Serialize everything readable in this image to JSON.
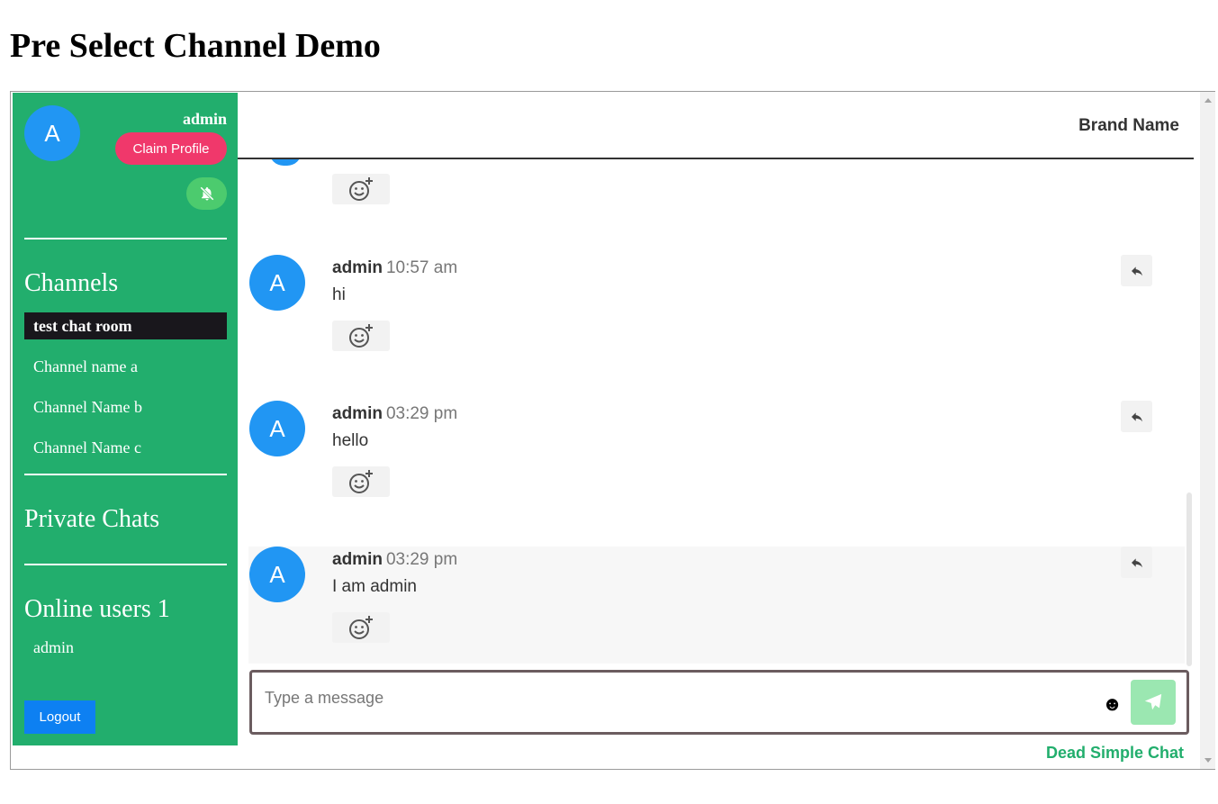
{
  "page": {
    "title": "Pre Select Channel Demo"
  },
  "sidebar": {
    "avatar_letter": "A",
    "username": "admin",
    "claim_profile_label": "Claim Profile",
    "channels_heading": "Channels",
    "channels": [
      {
        "label": "test chat room",
        "active": true
      },
      {
        "label": "Channel name a"
      },
      {
        "label": "Channel Name b"
      },
      {
        "label": "Channel Name c"
      }
    ],
    "private_chats_heading": "Private Chats",
    "online_users_heading": "Online users",
    "online_users_count": "1",
    "online_users": [
      "admin"
    ],
    "logout_label": "Logout"
  },
  "header": {
    "brand_name": "Brand Name"
  },
  "messages": [
    {
      "avatar": "A",
      "name": "admin",
      "time": "10:57 am",
      "text": "hi"
    },
    {
      "avatar": "A",
      "name": "admin",
      "time": "03:29 pm",
      "text": "hello"
    },
    {
      "avatar": "A",
      "name": "admin",
      "time": "03:29 pm",
      "text": "I am admin"
    }
  ],
  "composer": {
    "placeholder": "Type a message"
  },
  "footer": {
    "brand": "Dead Simple Chat"
  },
  "colors": {
    "sidebar_bg": "#22ae6d",
    "avatar": "#2196f3",
    "claim_button": "#f0386b",
    "active_channel": "#19171c",
    "logout_button": "#0d80f2",
    "send_button": "#9be7b1"
  },
  "icons": {
    "mute": "bell-slash-icon",
    "react": "emoji-add-icon",
    "reply": "reply-icon",
    "emoji": "emoji-icon",
    "send": "paper-plane-icon"
  }
}
